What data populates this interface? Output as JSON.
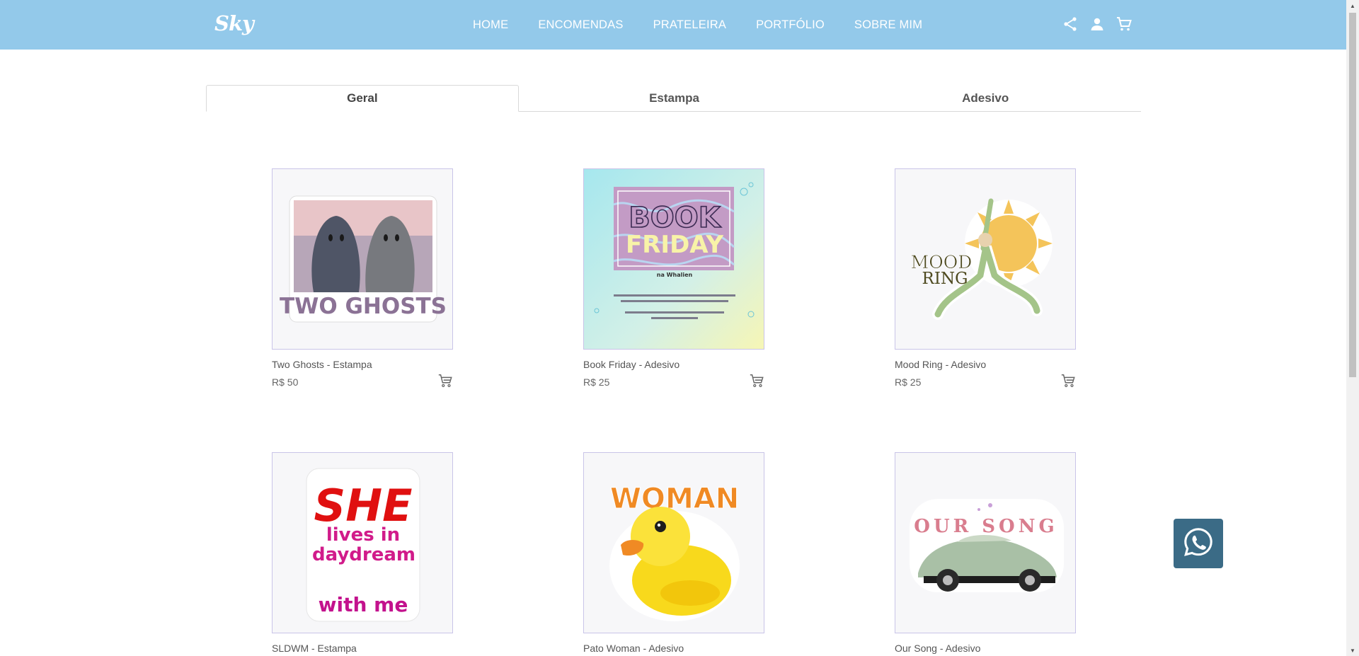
{
  "header": {
    "logo": "Sky",
    "nav": [
      "HOME",
      "ENCOMENDAS",
      "PRATELEIRA",
      "PORTFÓLIO",
      "SOBRE MIM"
    ],
    "icons": [
      "share-icon",
      "user-icon",
      "cart-icon"
    ]
  },
  "tabs": [
    {
      "label": "Geral",
      "active": true
    },
    {
      "label": "Estampa",
      "active": false
    },
    {
      "label": "Adesivo",
      "active": false
    }
  ],
  "products": [
    {
      "name": "Two Ghosts - Estampa",
      "price": "R$ 50",
      "art": {
        "top": "",
        "main": "TWO GHOSTS",
        "sub": ""
      }
    },
    {
      "name": "Book Friday - Adesivo",
      "price": "R$ 25",
      "art": {
        "top": "BOOK",
        "main": "FRIDAY",
        "sub": "na Whalien"
      }
    },
    {
      "name": "Mood Ring - Adesivo",
      "price": "R$ 25",
      "art": {
        "top": "MOOD",
        "main": "RING",
        "sub": ""
      }
    },
    {
      "name": "SLDWM - Estampa",
      "price": "",
      "art": {
        "top": "SHE",
        "main": "lives in daydreams",
        "sub": "with me"
      }
    },
    {
      "name": "Pato Woman - Adesivo",
      "price": "",
      "art": {
        "top": "WOMAN",
        "main": "",
        "sub": ""
      }
    },
    {
      "name": "Our Song - Adesivo",
      "price": "",
      "art": {
        "top": "OUR SONG",
        "main": "",
        "sub": ""
      }
    }
  ],
  "colors": {
    "header": "#93c9ea",
    "whatsapp": "#3b6b86",
    "card_border": "#c9c4e8"
  }
}
